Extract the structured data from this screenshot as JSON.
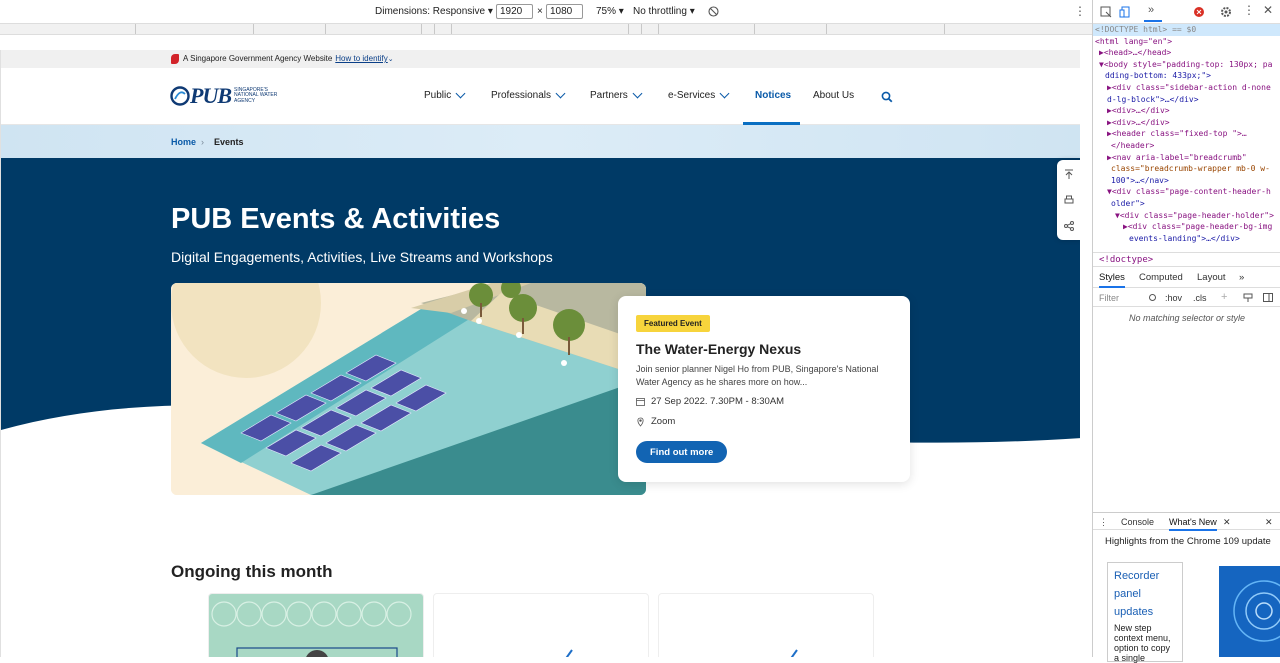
{
  "devtools_toolbar": {
    "dimensions_label": "Dimensions: Responsive",
    "width": "1920",
    "times": "×",
    "height": "1080",
    "zoom": "75%",
    "throttling": "No throttling"
  },
  "site": {
    "gov_banner": {
      "text": "A Singapore Government Agency Website",
      "link": "How to identify"
    },
    "logo": {
      "mark": "PUB",
      "subtitle": "SINGAPORE'S NATIONAL WATER AGENCY"
    },
    "nav": [
      {
        "label": "Public",
        "dropdown": true
      },
      {
        "label": "Professionals",
        "dropdown": true
      },
      {
        "label": "Partners",
        "dropdown": true
      },
      {
        "label": "e-Services",
        "dropdown": true
      },
      {
        "label": "Notices",
        "dropdown": false,
        "active": true
      },
      {
        "label": "About Us",
        "dropdown": false
      }
    ],
    "breadcrumb": {
      "home": "Home",
      "separator": "›",
      "current": "Events"
    },
    "hero": {
      "title": "PUB Events & Activities",
      "subtitle": "Digital Engagements, Activities, Live Streams and Workshops"
    },
    "featured": {
      "badge": "Featured Event",
      "title": "The Water-Energy Nexus",
      "description": "Join senior planner Nigel Ho from PUB, Singapore's National Water Agency as he shares more on how...",
      "date": "27 Sep 2022. 7.30PM - 8:30AM",
      "venue": "Zoom",
      "cta": "Find out more"
    },
    "ongoing": {
      "title": "Ongoing this month"
    },
    "colors": {
      "hero_bg": "#003a66",
      "accent": "#1264b3",
      "badge": "#f7d43c"
    }
  },
  "devtools": {
    "dom_lines": [
      {
        "indent": 0,
        "html": "<!DOCTYPE html> == $0",
        "selected": true
      },
      {
        "indent": 0,
        "html": "<html lang=\"en\">"
      },
      {
        "indent": 1,
        "html": "▶<head>…</head>"
      },
      {
        "indent": 1,
        "html": "▼<body style=\"padding-top: 130px; pa"
      },
      {
        "indent": 2,
        "html": "dding-bottom: 433px;\">"
      },
      {
        "indent": 2,
        "html": "▶<div class=\"sidebar-action d-none"
      },
      {
        "indent": 2,
        "html": "d-lg-block\">…</div>"
      },
      {
        "indent": 2,
        "html": "▶<div>…</div>"
      },
      {
        "indent": 2,
        "html": "▶<div>…</div>"
      },
      {
        "indent": 2,
        "html": "▶<header class=\"fixed-top \">…"
      },
      {
        "indent": 2,
        "html": "</header>"
      },
      {
        "indent": 2,
        "html": "▶<nav aria-label=\"breadcrumb\""
      },
      {
        "indent": 2,
        "html": "class=\"breadcrumb-wrapper mb-0 w-"
      },
      {
        "indent": 2,
        "html": "100\">…</nav>"
      },
      {
        "indent": 2,
        "html": "▼<div class=\"page-content-header-h"
      },
      {
        "indent": 2,
        "html": "older\">"
      },
      {
        "indent": 3,
        "html": "▼<div class=\"page-header-holder\">"
      },
      {
        "indent": 4,
        "html": "▶<div class=\"page-header-bg-img"
      },
      {
        "indent": 4,
        "html": "events-landing\">…</div>"
      }
    ],
    "crumb": "<!doctype>",
    "style_tabs": [
      "Styles",
      "Computed",
      "Layout",
      "»"
    ],
    "filter_placeholder": "Filter",
    "hov": ":hov",
    "cls": ".cls",
    "no_match": "No matching selector or style",
    "drawer_tabs": [
      "Console",
      "What's New"
    ],
    "highlights": "Highlights from the Chrome 109 update",
    "recorder_link": "Recorder panel updates",
    "recorder_desc": "New step context menu, option to copy a single"
  }
}
